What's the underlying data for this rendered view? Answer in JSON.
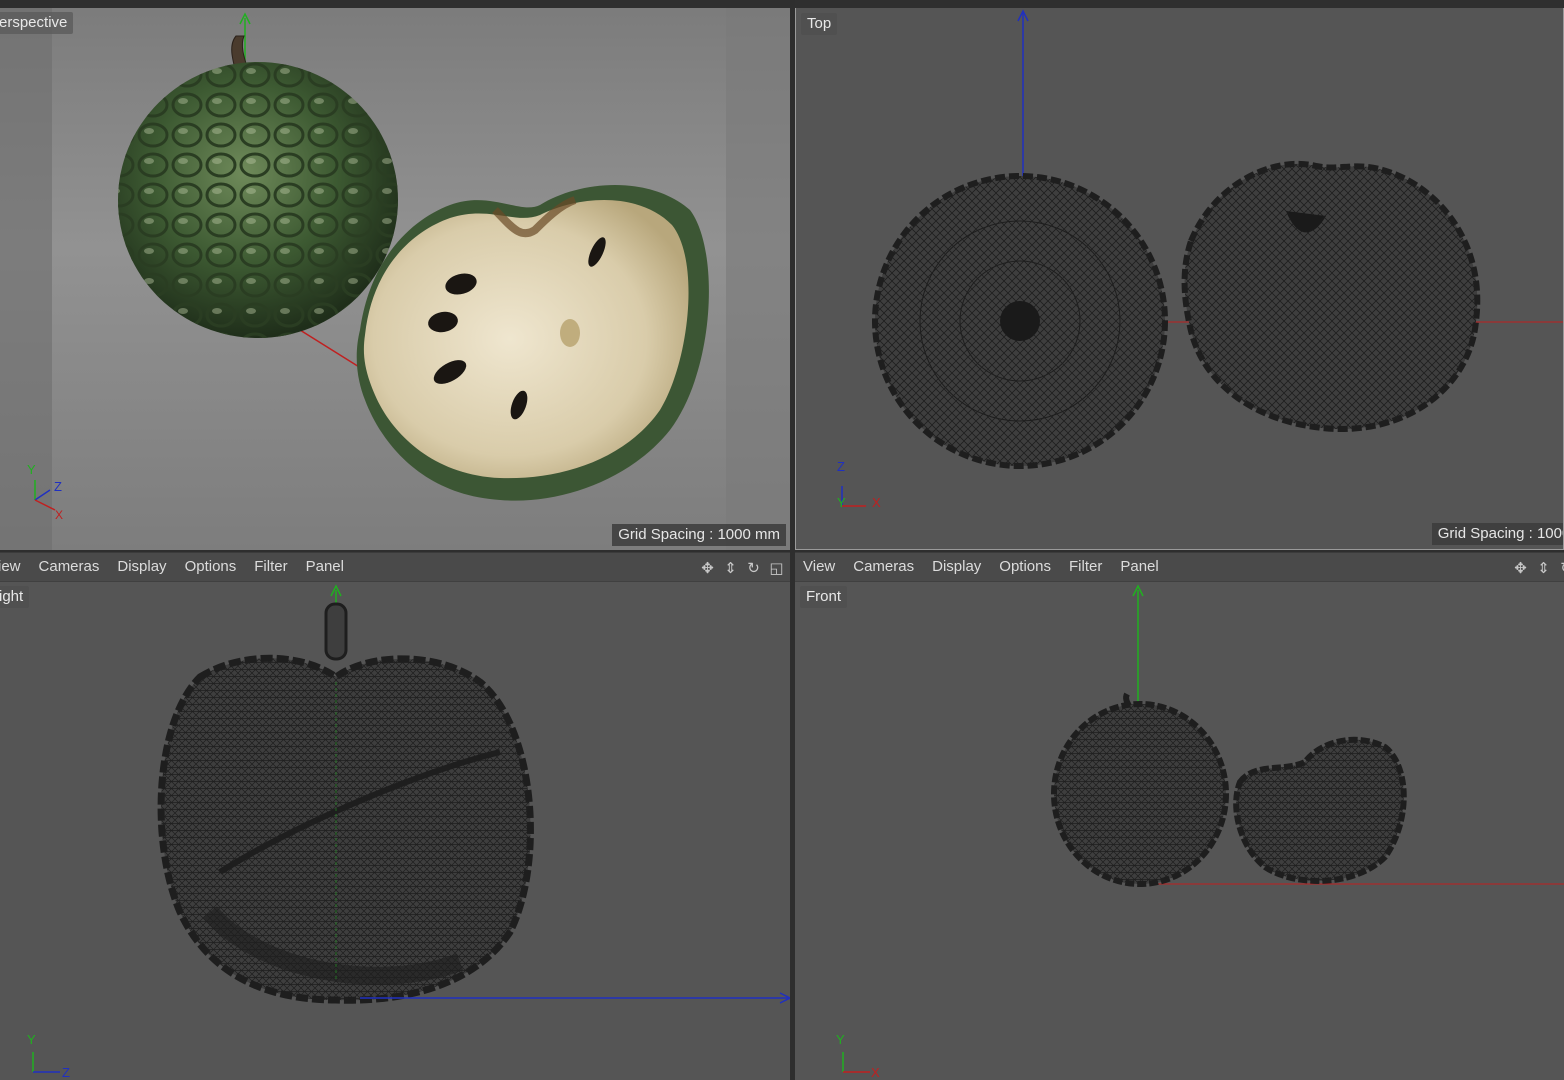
{
  "viewports": {
    "perspective": {
      "label": "erspective",
      "grid": "Grid Spacing : 1000 mm"
    },
    "top": {
      "label": "Top",
      "grid": "Grid Spacing : 1000 m"
    },
    "right": {
      "label": "ight"
    },
    "front": {
      "label": "Front"
    }
  },
  "menu": [
    "View",
    "Cameras",
    "Display",
    "Options",
    "Filter",
    "Panel"
  ],
  "menu_left_first": "iew",
  "nav_icons": [
    "move-icon",
    "zoom-icon",
    "rotate-icon",
    "maximize-icon"
  ],
  "axes": {
    "persp": {
      "y": "Y",
      "z": "Z",
      "x": "X"
    },
    "top": {
      "z": "Z",
      "y": "Y",
      "x": "X"
    },
    "right": {
      "y": "Y",
      "z": "Z"
    },
    "front": {
      "y": "Y",
      "x": "X"
    }
  },
  "colors": {
    "x_axis": "#d02020",
    "y_axis": "#20b020",
    "z_axis": "#2030c0",
    "wire": "#1e1e1e"
  }
}
